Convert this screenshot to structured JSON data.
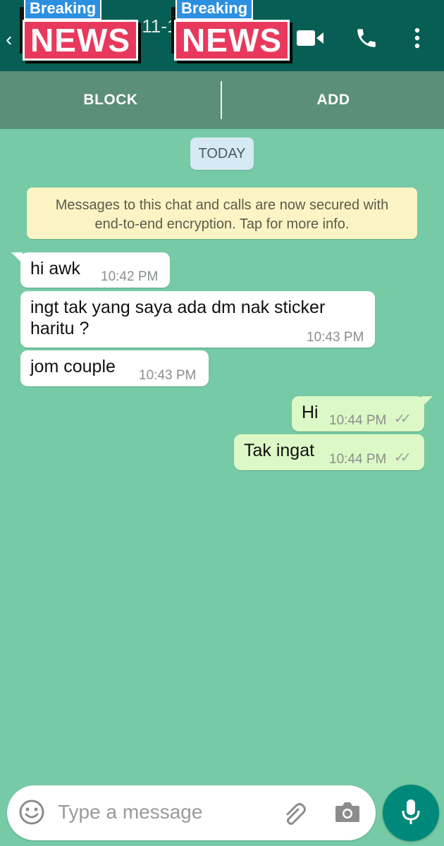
{
  "header": {
    "contact_title": "+60 11-1",
    "sticker_small_text": "Breaking",
    "sticker_big_text": "NEWS",
    "back_glyph": "‹",
    "icons": [
      "video-call-icon",
      "phone-call-icon",
      "more-options-icon"
    ]
  },
  "actions": {
    "block_label": "BLOCK",
    "add_label": "ADD"
  },
  "date_chip": "TODAY",
  "encryption_notice": {
    "line1": "Messages to this chat and calls are now secured with",
    "line2": "end-to-end encryption. Tap for more info."
  },
  "messages": [
    {
      "direction": "in",
      "text": "hi awk",
      "time": "10:42 PM"
    },
    {
      "direction": "in",
      "text_line1": "ingt tak yang saya ada dm nak sticker",
      "text_line2": "haritu ?",
      "time": "10:43 PM"
    },
    {
      "direction": "in",
      "text": "jom couple",
      "time": "10:43 PM"
    },
    {
      "direction": "out",
      "text": "Hi",
      "time": "10:44 PM",
      "status": "read"
    },
    {
      "direction": "out",
      "text": "Tak ingat",
      "time": "10:44 PM",
      "status": "read"
    }
  ],
  "composer": {
    "placeholder": "Type a message",
    "icons": [
      "emoji-icon",
      "attach-icon",
      "camera-icon",
      "mic-icon"
    ]
  },
  "colors": {
    "header": "#075e54",
    "action_bar": "#5b8f78",
    "chat_background": "#76cba6",
    "outgoing_bubble": "#dcf8c6",
    "mic_button": "#00897b"
  }
}
